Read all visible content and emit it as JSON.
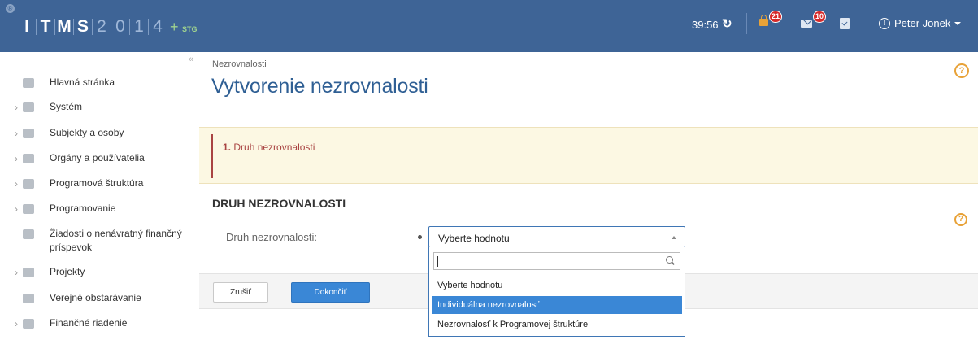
{
  "app": {
    "logo_badge": "®",
    "logo_letters": [
      "I",
      "T",
      "M",
      "S"
    ],
    "logo_digits": [
      "2",
      "0",
      "1",
      "4"
    ],
    "logo_plus": "+",
    "env": "STG",
    "session_timer": "39:56",
    "alerts_count": "21",
    "messages_count": "10",
    "user_name": "Peter Jonek",
    "brand_color": "#3e6496"
  },
  "sidebar": {
    "collapse_glyph": "«",
    "items": [
      {
        "label": "Hlavná stránka",
        "icon": "home-icon",
        "expandable": false
      },
      {
        "label": "Systém",
        "icon": "wrench-icon",
        "expandable": true
      },
      {
        "label": "Subjekty a osoby",
        "icon": "people-icon",
        "expandable": true
      },
      {
        "label": "Orgány a používatelia",
        "icon": "user-list-icon",
        "expandable": true
      },
      {
        "label": "Programová štruktúra",
        "icon": "sitemap-icon",
        "expandable": true
      },
      {
        "label": "Programovanie",
        "icon": "cubes-icon",
        "expandable": true
      },
      {
        "label": "Žiadosti o nenávratný finančný príspevok",
        "icon": "document-icon",
        "expandable": false
      },
      {
        "label": "Projekty",
        "icon": "folder-icon",
        "expandable": true
      },
      {
        "label": "Verejné obstarávanie",
        "icon": "briefcase-icon",
        "expandable": false
      },
      {
        "label": "Finančné riadenie",
        "icon": "finance-icon",
        "expandable": true
      }
    ]
  },
  "page": {
    "breadcrumb": "Nezrovnalosti",
    "title": "Vytvorenie nezrovnalosti",
    "step_number": "1.",
    "step_label": "Druh nezrovnalosti",
    "section_title": "DRUH NEZROVNALOSTI",
    "field_label": "Druh nezrovnalosti:",
    "select_value": "Vyberte hodnotu",
    "cancel_label": "Zrušiť",
    "finish_label": "Dokončiť",
    "help_glyph": "?"
  },
  "dropdown": {
    "search_value": "",
    "options": [
      {
        "label": "Vyberte hodnotu",
        "highlighted": false
      },
      {
        "label": "Individuálna nezrovnalosť",
        "highlighted": true
      },
      {
        "label": "Nezrovnalosť k Programovej štruktúre",
        "highlighted": false
      }
    ]
  },
  "colors": {
    "accent": "#3a87d6",
    "warning_band": "#fcf8e3",
    "step_text": "#a94442",
    "help_orange": "#e8a238"
  }
}
